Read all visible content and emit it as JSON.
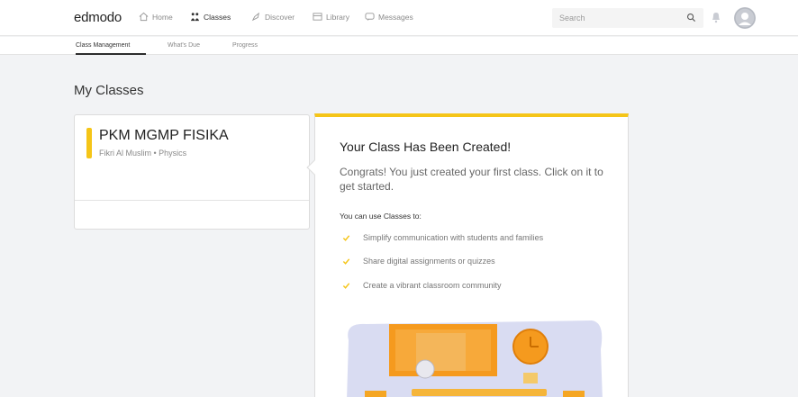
{
  "app": {
    "logo": "edmodo"
  },
  "nav": {
    "items": [
      {
        "label": "Home",
        "icon": "home-icon"
      },
      {
        "label": "Classes",
        "icon": "classes-icon",
        "active": true
      },
      {
        "label": "Discover",
        "icon": "discover-icon"
      },
      {
        "label": "Library",
        "icon": "library-icon"
      },
      {
        "label": "Messages",
        "icon": "messages-icon"
      }
    ]
  },
  "search": {
    "placeholder": "Search",
    "icon": "search-icon"
  },
  "subnav": {
    "tabs": [
      {
        "label": "Class Management",
        "active": true
      },
      {
        "label": "What's Due"
      },
      {
        "label": "Progress"
      }
    ]
  },
  "main": {
    "heading": "My Classes",
    "class_card": {
      "name": "PKM MGMP FISIKA",
      "meta": "Fikri Al Muslim • Physics",
      "accent": "#f5c518"
    },
    "popover": {
      "title": "Your Class Has Been Created!",
      "body": "Congrats! You just created your first class. Click on it to get started.",
      "use_label": "You can use Classes to:",
      "items": [
        "Simplify communication with students and families",
        "Share digital assignments or quizzes",
        "Create a vibrant classroom community"
      ],
      "accent": "#f5c518"
    }
  }
}
